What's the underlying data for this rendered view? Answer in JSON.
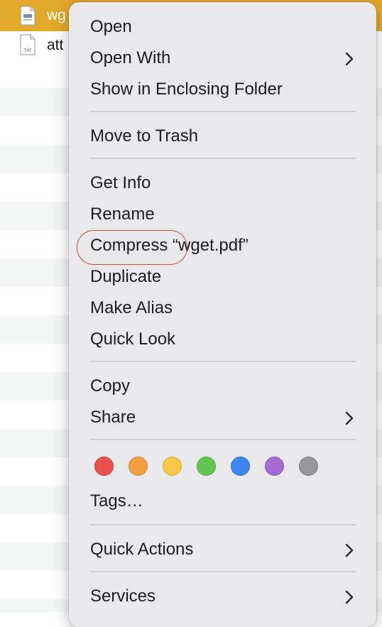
{
  "finder": {
    "rows": [
      {
        "name": "wg",
        "type": "pdf",
        "selected": true
      },
      {
        "name": "att",
        "type": "txt",
        "selected": false
      }
    ],
    "txt_badge": "TXT"
  },
  "context_menu": {
    "items": {
      "open": "Open",
      "open_with": "Open With",
      "show_in_enclosing_folder": "Show in Enclosing Folder",
      "move_to_trash": "Move to Trash",
      "get_info": "Get Info",
      "rename": "Rename",
      "compress": "Compress “wget.pdf”",
      "duplicate": "Duplicate",
      "make_alias": "Make Alias",
      "quick_look": "Quick Look",
      "copy": "Copy",
      "share": "Share",
      "tags": "Tags…",
      "quick_actions": "Quick Actions",
      "services": "Services"
    },
    "tag_colors": [
      {
        "name": "red",
        "fill": "#e8524a",
        "stroke": "#c8433c"
      },
      {
        "name": "orange",
        "fill": "#f0a040",
        "stroke": "#d08a33"
      },
      {
        "name": "yellow",
        "fill": "#f5c84a",
        "stroke": "#d6ab38"
      },
      {
        "name": "green",
        "fill": "#62c552",
        "stroke": "#4eaa41"
      },
      {
        "name": "blue",
        "fill": "#3d86f0",
        "stroke": "#2f6fd0"
      },
      {
        "name": "purple",
        "fill": "#a66bd3",
        "stroke": "#8b56b6"
      },
      {
        "name": "gray",
        "fill": "#98989c",
        "stroke": "#7e7e82"
      }
    ],
    "annotation": {
      "color": "#d54c36",
      "target": "compress"
    }
  }
}
